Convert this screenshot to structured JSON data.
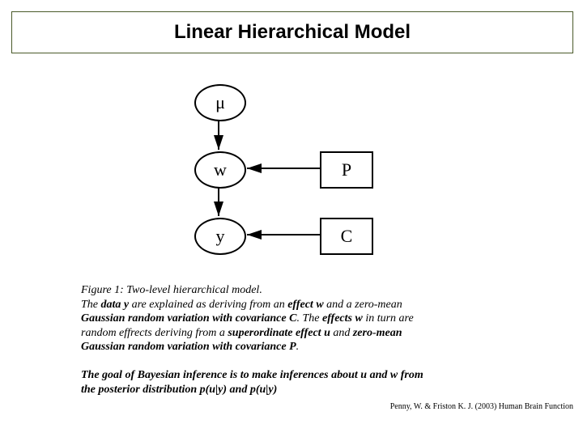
{
  "title": "Linear Hierarchical Model",
  "nodes": {
    "mu": "μ",
    "w": "w",
    "y": "y",
    "P": "P",
    "C": "C"
  },
  "caption": {
    "fig_label": "Figure 1: Two-level hierarchical model.",
    "line2_a": "The ",
    "line2_b": "data y",
    "line2_c": " are explained as deriving from an ",
    "line2_d": "effect w",
    "line2_e": " and a zero-mean",
    "line3_a": "Gaussian random variation with covariance C",
    "line3_b": ". The ",
    "line3_c": "effects w",
    "line3_d": " in turn are",
    "line4_a": "random effrects deriving from a ",
    "line4_b": "superordinate effect u",
    "line4_c": " and ",
    "line4_d": "zero-mean",
    "line5_a": "Gaussian random variation with covariance P",
    "line5_b": "."
  },
  "goal": {
    "line1": "The goal of Bayesian inference is to make inferences about u and w from",
    "line2": "the posterior distribution p(u|y) and p(u|y)"
  },
  "citation": "Penny, W. & Friston K. J. (2003) Human Brain Function"
}
